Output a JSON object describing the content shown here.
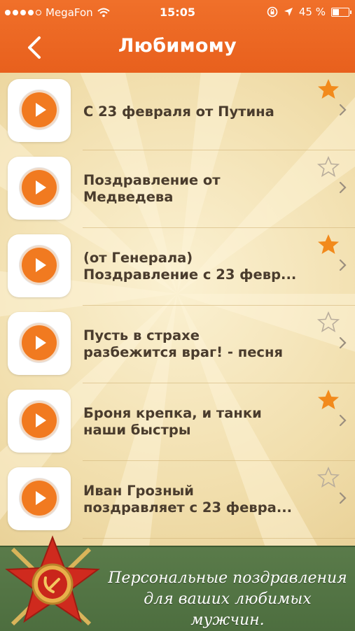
{
  "status": {
    "carrier": "MegaFon",
    "time": "15:05",
    "battery": "45 %",
    "battery_level": 0.45,
    "signal_bars": 4,
    "signal_total": 5
  },
  "nav": {
    "title": "Любимому"
  },
  "items": [
    {
      "label": "С 23 февраля от Путина",
      "favorite": true
    },
    {
      "label": "Поздравление от\nМедведева",
      "favorite": false
    },
    {
      "label": "(от Генерала)\nПоздравление с 23 февр...",
      "favorite": true
    },
    {
      "label": "Пусть в страхе\nразбежится враг! - песня",
      "favorite": false
    },
    {
      "label": "Броня крепка, и танки\nнаши быстры",
      "favorite": true
    },
    {
      "label": "Иван Грозный\nпоздравляет с 23 февра...",
      "favorite": false
    }
  ],
  "banner": {
    "text": "Персональные поздравления\nдля ваших любимых мужчин."
  },
  "colors": {
    "accent": "#f17a20",
    "header": "#e8601d",
    "banner": "#52724a",
    "text": "#4a3c2d"
  }
}
